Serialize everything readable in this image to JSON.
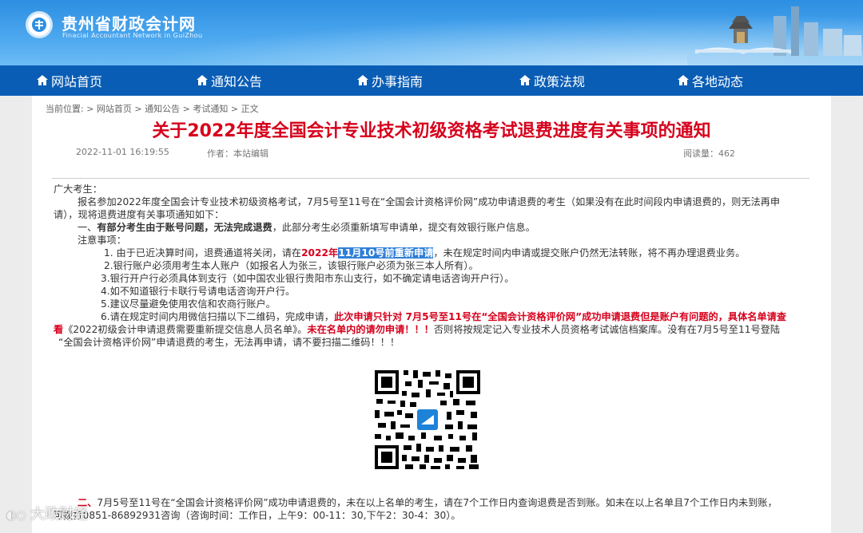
{
  "header": {
    "site_title": "贵州省财政会计网",
    "site_subtitle": "Finacial  Accountant Network in GuiZhou"
  },
  "nav": {
    "items": [
      {
        "label": "网站首页"
      },
      {
        "label": "通知公告"
      },
      {
        "label": "办事指南"
      },
      {
        "label": "政策法规"
      },
      {
        "label": "各地动态"
      }
    ]
  },
  "breadcrumb": {
    "prefix": "当前位置: > ",
    "items": [
      "网站首页",
      "通知公告",
      "考试通知",
      "正文"
    ],
    "sep": " > "
  },
  "article": {
    "title": "关于2022年度全国会计专业技术初级资格考试退费进度有关事项的通知",
    "date": "2022-11-01 16:19:55",
    "author": "作者：本站编辑",
    "views": "阅读量：462",
    "greeting": "广大考生：",
    "para1_a": "报名参加2022年度全国会计专业技术初级资格考试，7月5号至11号在“全国会计资格评价网”成功申请退费的考生（如果没有在此时间段内申请退费的，则无法再申",
    "para1_b": "请），现将退费进度有关事项通知如下：",
    "sec1_prefix": "一、",
    "sec1_bold": "有部分考生由于账号问题，无法完成退费",
    "sec1_rest": "，此部分考生必须重新填写申请单，提交有效银行账户信息。",
    "notes_head": "注意事项：",
    "note1_a": "1. 由于已近决算时间，退费通道将关闭，请在",
    "note1_red1": "2022年",
    "note1_hl": "11月10号前重新申请",
    "note1_rest": "，未在规定时间内申请或提交账户仍然无法转账，将不再办理退费业务。",
    "note2": "2.银行账户必须用考生本人账户（如报名人为张三，该银行账户必须为张三本人所有）。",
    "note3": "3.银行开户行必须具体到支行（如中国农业银行贵阳市东山支行，如不确定请电话咨询开户行）。",
    "note4": "4.如不知道银行卡联行号请电话咨询开户行。",
    "note5": "5.建议尽量避免使用农信和农商行账户。",
    "note6_a": "6.请在规定时间内用微信扫描以下二维码，完成申请，",
    "note6_red": "此次申请只针对 7月5号至11号在“全国会计资格评价网”成功申请退费但是账户有问题的，具体名单请查",
    "note6_b_red1": "看",
    "note6_b_text": "《2022初级会计申请退费需要重新提交信息人员名单》。",
    "note6_b_red2": "未在名单内的请勿申请！！！",
    "note6_b_rest": "否则将按规定记入专业技术人员资格考试诚信档案库。没有在7月5号至11号登陆",
    "note6_c": "“全国会计资格评价网”申请退费的考生，无法再申请，请不要扫描二维码！！！",
    "sec2_prefix": "二、",
    "sec2_a": "7月5号至11号在“全国会计资格评价网”成功申请退费的，未在以上名单的考生，请在7个工作日内查询退费是否到账。如未在以上名单且7个工作日内未到账，",
    "sec2_b": "可拨打0851-86892931咨询（咨询时间：工作日，上午9：00-11：30,下午2：30-4：30）。"
  },
  "watermark": "大政财经",
  "colors": {
    "header_blue": "#2d8fe2",
    "nav_blue": "#0a5db5",
    "title_red": "#d6001c",
    "highlight": "#2f7fd8"
  }
}
